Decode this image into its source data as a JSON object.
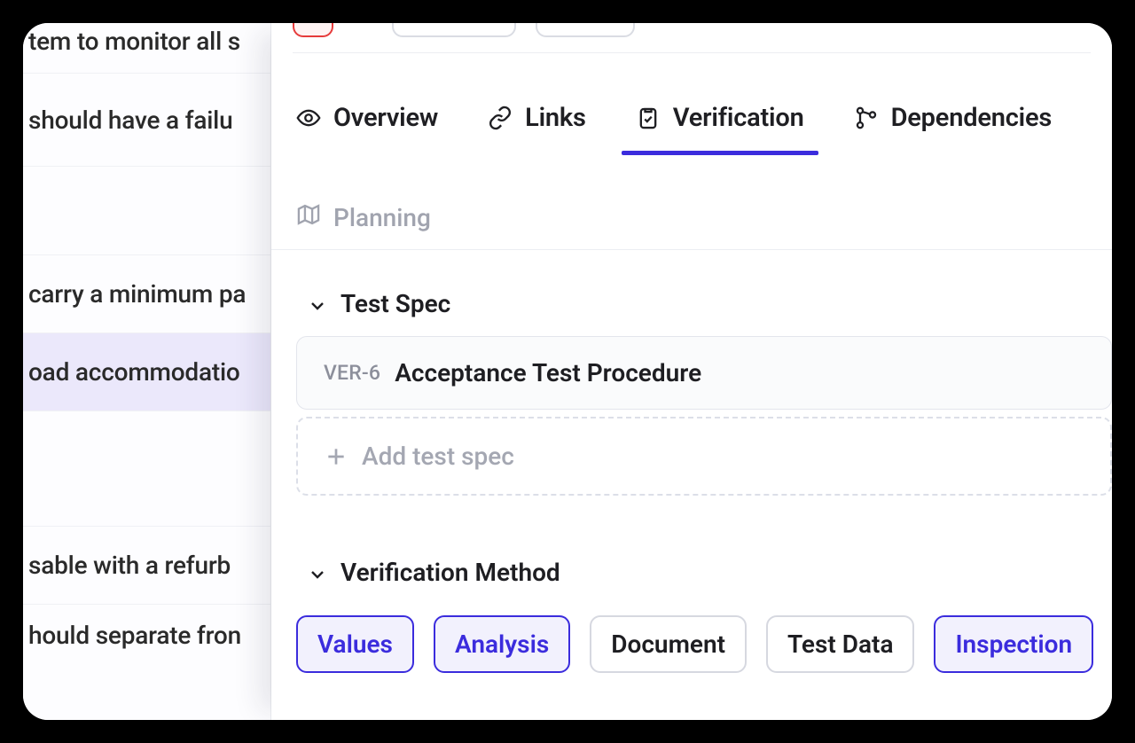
{
  "bg_list": {
    "rows": [
      "tem to monitor all s",
      "should have a failu",
      "",
      "carry a minimum pa",
      "oad accommodatio",
      "",
      "sable with a refurb",
      "hould separate fron"
    ],
    "selected_index": 4
  },
  "tabs": [
    {
      "label": "Overview",
      "icon": "eye",
      "active": false
    },
    {
      "label": "Links",
      "icon": "link",
      "active": false
    },
    {
      "label": "Verification",
      "icon": "clipboard-check",
      "active": true
    },
    {
      "label": "Dependencies",
      "icon": "branch",
      "active": false
    }
  ],
  "planning": {
    "label": "Planning"
  },
  "test_spec": {
    "heading": "Test Spec",
    "item": {
      "id": "VER-6",
      "title": "Acceptance Test Procedure"
    },
    "add_label": "Add test spec"
  },
  "verification_method": {
    "heading": "Verification Method",
    "pills": [
      {
        "label": "Values",
        "active": true
      },
      {
        "label": "Analysis",
        "active": true
      },
      {
        "label": "Document",
        "active": false
      },
      {
        "label": "Test Data",
        "active": false
      },
      {
        "label": "Inspection",
        "active": true
      }
    ]
  }
}
